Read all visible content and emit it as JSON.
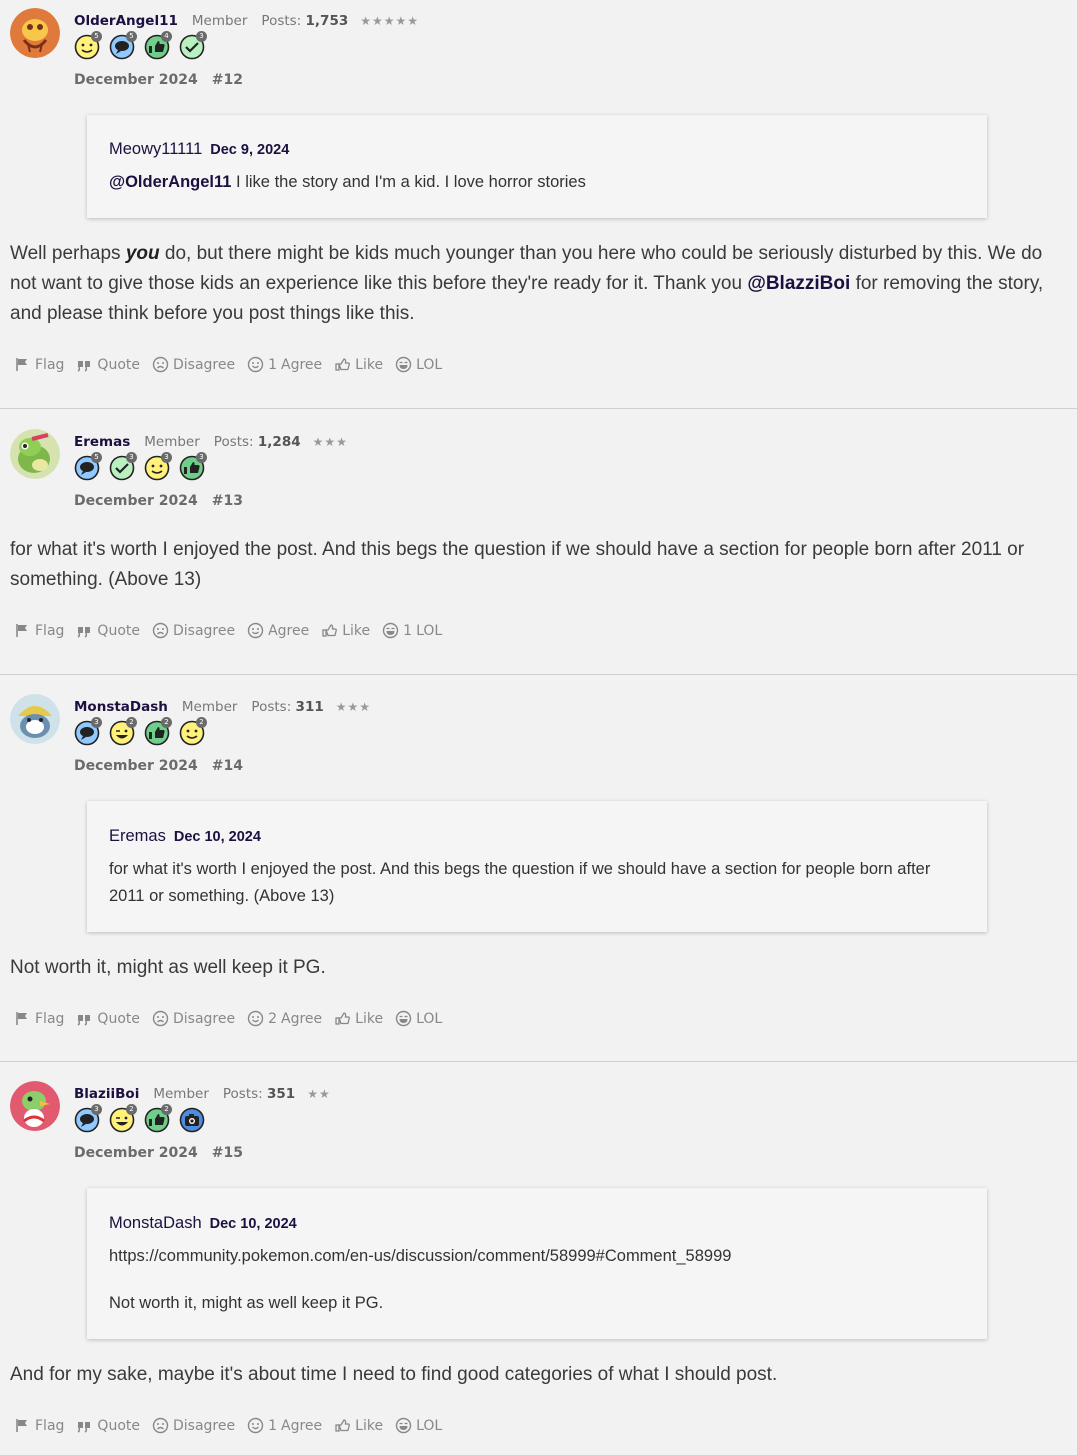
{
  "actions_labels": {
    "flag": "Flag",
    "quote": "Quote",
    "disagree": "Disagree",
    "agree": "Agree",
    "like": "Like",
    "lol": "LOL"
  },
  "posts": [
    {
      "username": "OlderAngel11",
      "rank": "Member",
      "posts_label": "Posts:",
      "posts_count": "1,753",
      "stars": "★★★★★",
      "badges": [
        "5",
        "5",
        "4",
        "3"
      ],
      "date": "December 2024",
      "number": "#12",
      "quote": {
        "author": "Meowy11111",
        "date": "Dec 9, 2024",
        "mention": "@OlderAngel11",
        "text": " I like the story and I'm a kid. I love horror stories"
      },
      "body_part1": "Well perhaps ",
      "body_em": "you",
      "body_part2": " do, but there might be kids much younger than you here who could be seriously disturbed by this. We do not want to give those kids an experience like this before they're ready for it. Thank you ",
      "body_mention": "@BlazziBoi",
      "body_part3": " for removing the story, and please think before you post things like this.",
      "agree_count": "1",
      "lol_count": ""
    },
    {
      "username": "Eremas",
      "rank": "Member",
      "posts_label": "Posts:",
      "posts_count": "1,284",
      "stars": "★★★",
      "badges": [
        "5",
        "3",
        "3",
        "3"
      ],
      "date": "December 2024",
      "number": "#13",
      "body": "for what it's worth I enjoyed the post. And this begs the question if we should have a section for people born after 2011 or something. (Above 13)",
      "agree_count": "",
      "lol_count": "1"
    },
    {
      "username": "MonstaDash",
      "rank": "Member",
      "posts_label": "Posts:",
      "posts_count": "311",
      "stars": "★★★",
      "badges": [
        "3",
        "2",
        "2",
        "2"
      ],
      "date": "December 2024",
      "number": "#14",
      "quote": {
        "author": "Eremas",
        "date": "Dec 10, 2024",
        "text": "for what it's worth I enjoyed the post. And this begs the question if we should have a section for people born after 2011 or something. (Above 13)"
      },
      "body": "Not worth it, might as well keep it PG.",
      "agree_count": "2",
      "lol_count": ""
    },
    {
      "username": "BlaziiBoi",
      "rank": "Member",
      "posts_label": "Posts:",
      "posts_count": "351",
      "stars": "★★",
      "badges": [
        "3",
        "2",
        "2",
        ""
      ],
      "date": "December 2024",
      "number": "#15",
      "quote": {
        "author": "MonstaDash",
        "date": "Dec 10, 2024",
        "link": "https://community.pokemon.com/en-us/discussion/comment/58999#Comment_58999",
        "text": "Not worth it, might as well keep it PG."
      },
      "body": "And for my sake, maybe it's about time I need to find good categories of what I should post.",
      "agree_count": "1",
      "lol_count": ""
    }
  ],
  "colors": {
    "background": "#f2f2f2",
    "username": "#1d1040",
    "muted": "#888888"
  }
}
